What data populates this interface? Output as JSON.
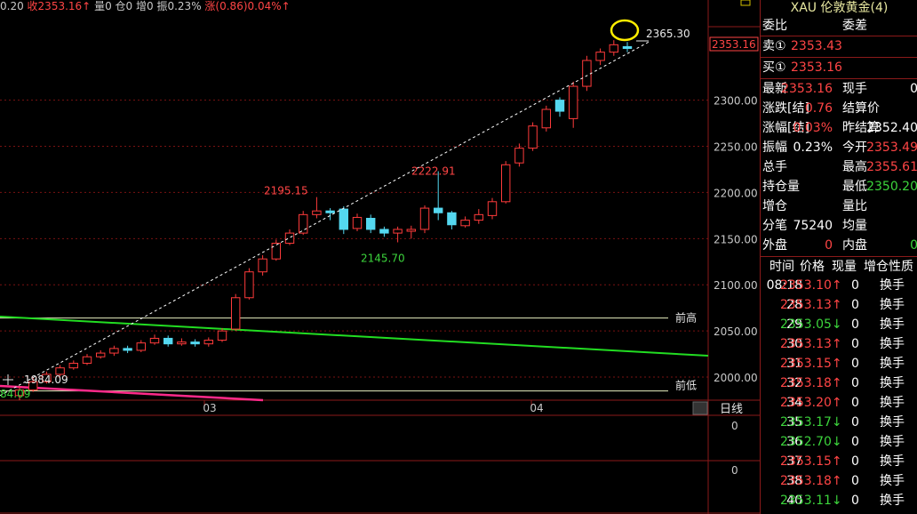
{
  "topbar": {
    "pre": "0.20",
    "close": "收2353.16↑",
    "vol": "量0",
    "pos": "仓0",
    "inc": "增0",
    "amp": "振0.23%",
    "chg": "涨(0.86)0.04%↑"
  },
  "panel": {
    "title": "XAU 伦敦黄金(4)",
    "bid_ratio_label": "委比",
    "bid_diff_label": "委差",
    "sell_label": "卖①",
    "sell_price": "2353.43",
    "buy_label": "买①",
    "buy_price": "2353.16",
    "stats": [
      {
        "l1": "最新",
        "v1": "2353.16",
        "c1": "up",
        "l2": "现手",
        "v2": "0",
        "c2": "wh"
      },
      {
        "l1": "涨跌[结]",
        "v1": "0.76",
        "c1": "up",
        "l2": "结算价",
        "v2": "",
        "c2": "wh"
      },
      {
        "l1": "涨幅[结]",
        "v1": "0.03%",
        "c1": "up",
        "l2": "昨结算",
        "v2": "2352.40",
        "c2": "wh"
      },
      {
        "l1": "振幅",
        "v1": "0.23%",
        "c1": "wh",
        "l2": "今开",
        "v2": "2353.49",
        "c2": "up"
      },
      {
        "l1": "总手",
        "v1": "",
        "c1": "wh",
        "l2": "最高",
        "v2": "2355.61",
        "c2": "up"
      },
      {
        "l1": "持仓量",
        "v1": "",
        "c1": "wh",
        "l2": "最低",
        "v2": "2350.20",
        "c2": "dn"
      },
      {
        "l1": "增仓",
        "v1": "",
        "c1": "wh",
        "l2": "量比",
        "v2": "",
        "c2": "wh"
      },
      {
        "l1": "分笔",
        "v1": "75240",
        "c1": "wh",
        "l2": "均量",
        "v2": "",
        "c2": "wh"
      },
      {
        "l1": "外盘",
        "v1": "0",
        "c1": "up",
        "l2": "内盘",
        "v2": "0",
        "c2": "dn"
      }
    ],
    "trade_headers": [
      "时间",
      "价格",
      "现量",
      "增仓",
      "性质"
    ],
    "trades": [
      {
        "time": "08:18",
        "price": "2353.10",
        "dir": "↑",
        "c": "up",
        "vol": "0",
        "type": "换手"
      },
      {
        "time": "28",
        "price": "2353.13",
        "dir": "↑",
        "c": "up",
        "vol": "0",
        "type": "换手"
      },
      {
        "time": "29",
        "price": "2353.05",
        "dir": "↓",
        "c": "dn",
        "vol": "0",
        "type": "换手"
      },
      {
        "time": "30",
        "price": "2353.13",
        "dir": "↑",
        "c": "up",
        "vol": "0",
        "type": "换手"
      },
      {
        "time": "31",
        "price": "2353.15",
        "dir": "↑",
        "c": "up",
        "vol": "0",
        "type": "换手"
      },
      {
        "time": "32",
        "price": "2353.18",
        "dir": "↑",
        "c": "up",
        "vol": "0",
        "type": "换手"
      },
      {
        "time": "34",
        "price": "2353.20",
        "dir": "↑",
        "c": "up",
        "vol": "0",
        "type": "换手"
      },
      {
        "time": "35",
        "price": "2353.17",
        "dir": "↓",
        "c": "dn",
        "vol": "0",
        "type": "换手"
      },
      {
        "time": "36",
        "price": "2352.70",
        "dir": "↓",
        "c": "dn",
        "vol": "0",
        "type": "换手"
      },
      {
        "time": "37",
        "price": "2353.15",
        "dir": "↑",
        "c": "up",
        "vol": "0",
        "type": "换手"
      },
      {
        "time": "38",
        "price": "2353.18",
        "dir": "↑",
        "c": "up",
        "vol": "0",
        "type": "换手"
      },
      {
        "time": "40",
        "price": "2353.11",
        "dir": "↓",
        "c": "dn",
        "vol": "0",
        "type": "换手"
      }
    ]
  },
  "chart_data": {
    "type": "candlestick",
    "y_ticks": [
      "2300.00",
      "2250.00",
      "2200.00",
      "2150.00",
      "2100.00",
      "2050.00",
      "2000.00"
    ],
    "ylim": [
      1975,
      2395
    ],
    "x_ticks": [
      "03",
      "04"
    ],
    "current_price": "2353.16",
    "annotations": {
      "high_label": "2365.30",
      "peak_mar": "2195.15",
      "trough": "2145.70",
      "spike": "2222.91",
      "low_left": "1984.09",
      "low_left2": "84.09"
    },
    "prev_high_label": "前高",
    "prev_low_label": "前低",
    "prev_high": 2064,
    "prev_low": 1985,
    "period_label": "日线",
    "sub_zero": "0",
    "sub2_zero": "0",
    "colors": {
      "up": "#ff3b3b",
      "down": "#54d8f0",
      "trend_green": "#22dd22",
      "trend_magenta": "#ff2a8a",
      "grid": "#7a1212",
      "axis": "#8b1a1a"
    },
    "candles": [
      [
        1980,
        1986,
        1975,
        1990
      ],
      [
        1986,
        1995,
        1984,
        2000
      ],
      [
        1995,
        2003,
        1993,
        2006
      ],
      [
        2003,
        2010,
        2001,
        2013
      ],
      [
        2010,
        2015,
        2008,
        2018
      ],
      [
        2015,
        2022,
        2013,
        2025
      ],
      [
        2022,
        2026,
        2020,
        2029
      ],
      [
        2026,
        2031,
        2023,
        2034
      ],
      [
        2031,
        2029,
        2026,
        2034
      ],
      [
        2029,
        2037,
        2027,
        2040
      ],
      [
        2037,
        2042,
        2035,
        2046
      ],
      [
        2042,
        2036,
        2033,
        2045
      ],
      [
        2036,
        2038,
        2034,
        2042
      ],
      [
        2038,
        2036,
        2033,
        2041
      ],
      [
        2036,
        2040,
        2033,
        2043
      ],
      [
        2040,
        2050,
        2038,
        2053
      ],
      [
        2052,
        2086,
        2050,
        2090
      ],
      [
        2086,
        2114,
        2084,
        2118
      ],
      [
        2114,
        2128,
        2110,
        2132
      ],
      [
        2128,
        2145,
        2126,
        2149
      ],
      [
        2145,
        2156,
        2143,
        2160
      ],
      [
        2156,
        2176,
        2154,
        2180
      ],
      [
        2176,
        2180,
        2172,
        2195
      ],
      [
        2180,
        2178,
        2170,
        2183
      ],
      [
        2182,
        2160,
        2155,
        2185
      ],
      [
        2161,
        2173,
        2158,
        2177
      ],
      [
        2172,
        2160,
        2156,
        2176
      ],
      [
        2160,
        2156,
        2152,
        2163
      ],
      [
        2156,
        2160,
        2146,
        2163
      ],
      [
        2158,
        2160,
        2150,
        2164
      ],
      [
        2160,
        2183,
        2156,
        2186
      ],
      [
        2183,
        2178,
        2170,
        2223
      ],
      [
        2178,
        2165,
        2160,
        2180
      ],
      [
        2164,
        2170,
        2162,
        2174
      ],
      [
        2170,
        2176,
        2166,
        2182
      ],
      [
        2175,
        2190,
        2171,
        2194
      ],
      [
        2190,
        2230,
        2188,
        2234
      ],
      [
        2232,
        2248,
        2228,
        2253
      ],
      [
        2248,
        2272,
        2245,
        2276
      ],
      [
        2270,
        2290,
        2266,
        2294
      ],
      [
        2300,
        2288,
        2282,
        2303
      ],
      [
        2280,
        2315,
        2270,
        2320
      ],
      [
        2315,
        2343,
        2310,
        2348
      ],
      [
        2343,
        2352,
        2338,
        2356
      ],
      [
        2352,
        2360,
        2348,
        2365
      ],
      [
        2358,
        2356,
        2352,
        2363
      ]
    ]
  }
}
